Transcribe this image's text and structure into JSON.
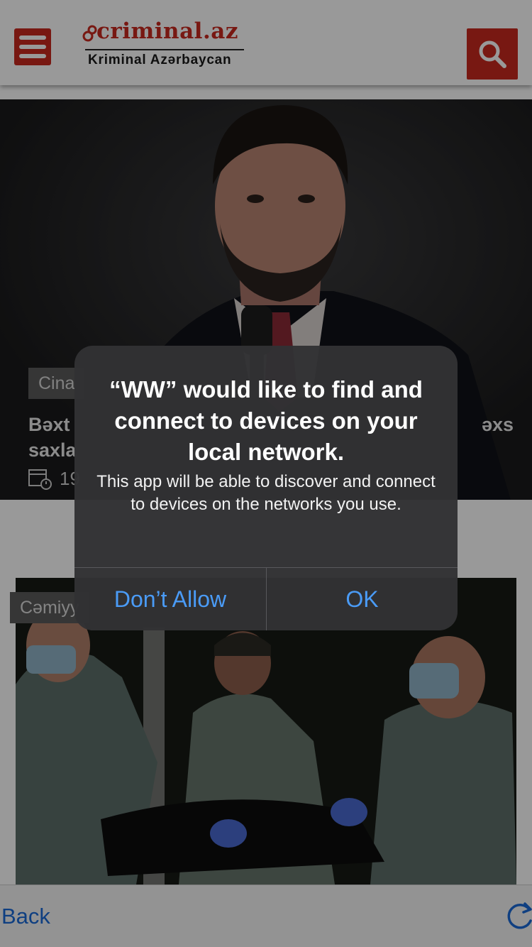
{
  "header": {
    "logo_title": "criminal.az",
    "logo_subtitle": "Kriminal Azərbaycan",
    "menu_icon": "hamburger-menu-icon",
    "search_icon": "search-icon",
    "brand_color": "#c8281e"
  },
  "hero": {
    "category": "Cina",
    "title_line1": "Bəxt",
    "title_line1_end": "əxs",
    "title_line2": "saxla",
    "date_partial": "19",
    "date_icon": "calendar-clock-icon"
  },
  "article2": {
    "category": "Cəmiyy"
  },
  "bottom_bar": {
    "back_label": "Back",
    "reload_icon": "reload-icon",
    "link_color": "#1a6ad8"
  },
  "alert": {
    "title": "“WW” would like to find and connect to devices on your local network.",
    "message": "This app will be able to discover and connect to devices on the networks you use.",
    "deny_label": "Don’t Allow",
    "ok_label": "OK",
    "button_color": "#4a9bf6"
  }
}
